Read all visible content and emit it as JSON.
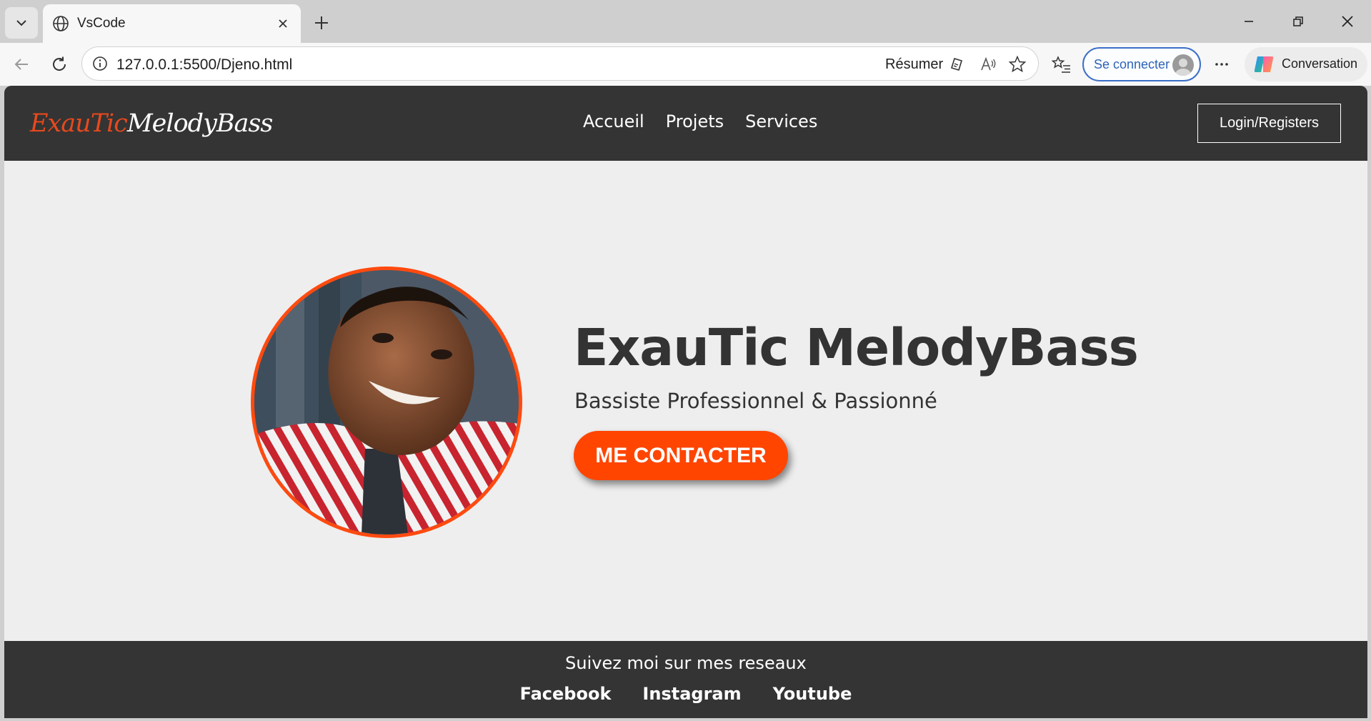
{
  "browser": {
    "tab": {
      "title": "VsCode",
      "favicon": "globe-icon"
    },
    "url": "127.0.0.1:5500/Djeno.html",
    "summarize_label": "Résumer",
    "signin_label": "Se connecter",
    "copilot_label": "Conversation"
  },
  "site": {
    "logo_part1": "ExauTic",
    "logo_part2": "MelodyBass",
    "nav": [
      "Accueil",
      "Projets",
      "Services"
    ],
    "login_label": "Login/Registers",
    "hero": {
      "title": "ExauTic MelodyBass",
      "subtitle": "Bassiste Professionnel & Passionné",
      "cta_label": "ME CONTACTER"
    },
    "footer": {
      "text": "Suivez moi sur mes reseaux",
      "links": [
        "Facebook",
        "Instagram",
        "Youtube"
      ]
    }
  },
  "colors": {
    "accent": "#ff4500",
    "header_bg": "#343434",
    "page_bg": "#eeeeee"
  }
}
